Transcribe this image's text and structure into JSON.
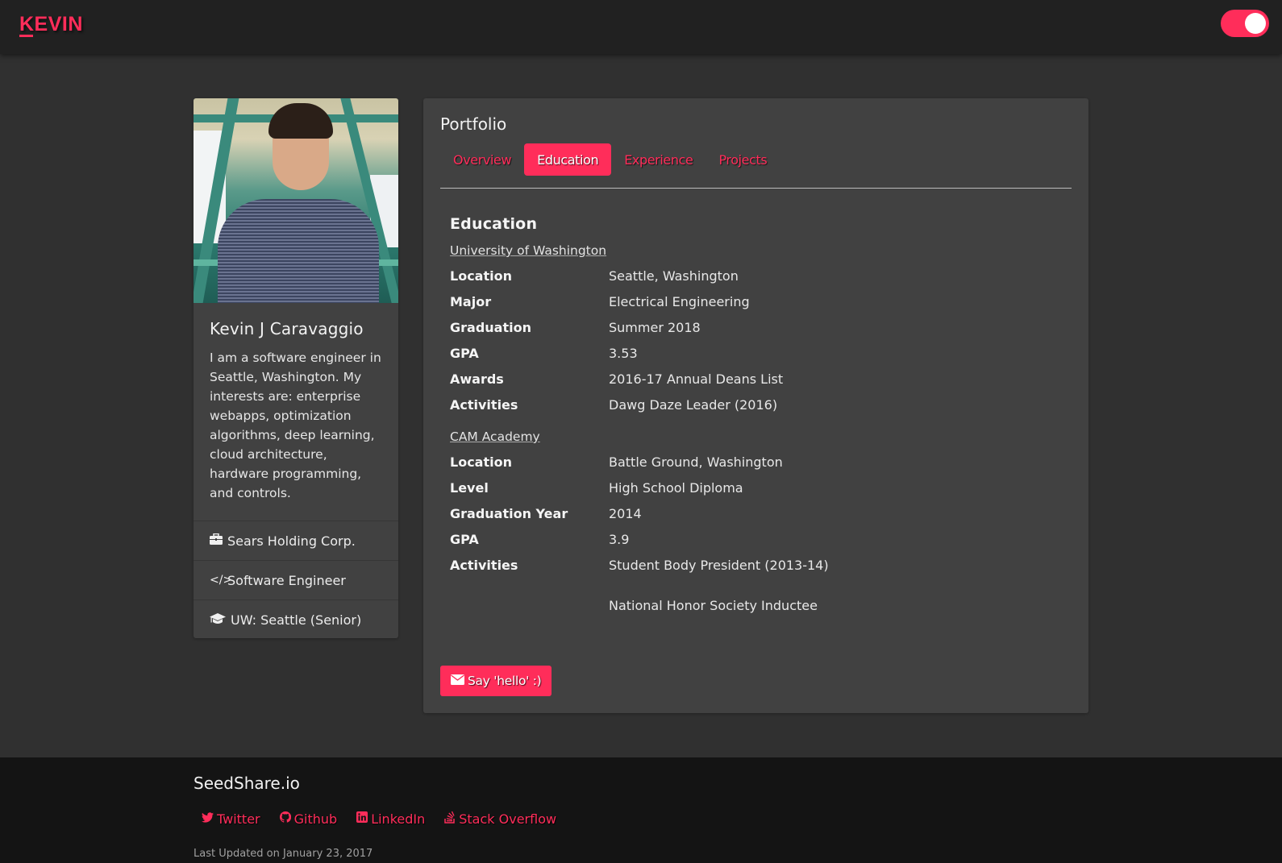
{
  "navbar": {
    "brand": "KEVIN",
    "theme_toggle": {
      "state": "on",
      "color": "#ff2d5a"
    }
  },
  "profile": {
    "photo_alt": "Photo of Kevin J Caravaggio on a green steel footbridge",
    "name": "Kevin J Caravaggio",
    "bio": "I am a software engineer in Seattle, Washington. My interests are: enterprise webapps, optimization algorithms, deep learning, cloud architecture, hardware programming, and controls.",
    "items": [
      {
        "icon": "briefcase-icon",
        "glyph": "💼",
        "label": "Sears Holding Corp."
      },
      {
        "icon": "code-icon",
        "glyph": "</>",
        "label": "Software Engineer"
      },
      {
        "icon": "graduation-cap-icon",
        "glyph": "🎓",
        "label": "UW: Seattle (Senior)"
      }
    ]
  },
  "portfolio": {
    "title": "Portfolio",
    "tabs": [
      {
        "label": "Overview",
        "active": false
      },
      {
        "label": "Education",
        "active": true
      },
      {
        "label": "Experience",
        "active": false
      },
      {
        "label": "Projects",
        "active": false
      }
    ],
    "education": {
      "heading": "Education",
      "schools": [
        {
          "name": "University of Washington",
          "rows": [
            {
              "key": "Location",
              "value": "Seattle, Washington"
            },
            {
              "key": "Major",
              "value": "Electrical Engineering"
            },
            {
              "key": "Graduation",
              "value": "Summer 2018"
            },
            {
              "key": "GPA",
              "value": "3.53"
            },
            {
              "key": "Awards",
              "value": "2016-17 Annual Deans List"
            },
            {
              "key": "Activities",
              "value": "Dawg Daze Leader (2016)"
            }
          ]
        },
        {
          "name": "CAM Academy",
          "rows": [
            {
              "key": "Location",
              "value": "Battle Ground, Washington"
            },
            {
              "key": "Level",
              "value": "High School Diploma"
            },
            {
              "key": "Graduation Year",
              "value": "2014"
            },
            {
              "key": "GPA",
              "value": "3.9"
            },
            {
              "key": "Activities",
              "value": "Student Body President (2013-14)"
            },
            {
              "key": "",
              "value": "National Honor Society Inductee"
            }
          ]
        }
      ]
    },
    "contact_button": "Say 'hello' :)"
  },
  "footer": {
    "title": "SeedShare.io",
    "links": [
      {
        "icon": "twitter-icon",
        "label": "Twitter"
      },
      {
        "icon": "github-icon",
        "label": "Github"
      },
      {
        "icon": "linkedin-icon",
        "label": "LinkedIn"
      },
      {
        "icon": "stack-overflow-icon",
        "label": "Stack Overflow"
      }
    ],
    "last_updated": "Last Updated on January 23, 2017"
  },
  "colors": {
    "accent": "#ff2d5a",
    "navbar_bg": "#212121",
    "page_bg": "#303030",
    "card_bg": "#414141",
    "footer_bg": "#141414"
  }
}
